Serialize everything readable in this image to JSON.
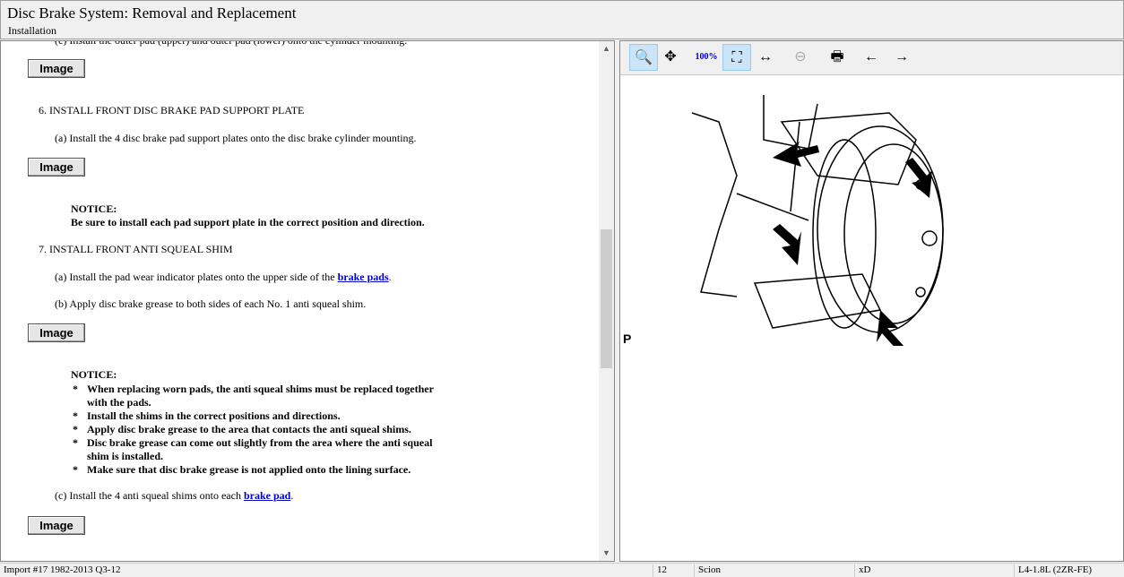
{
  "header": {
    "title": "Disc Brake System:  Removal and Replacement",
    "subtitle": "Installation"
  },
  "content": {
    "cut_line": "(c) Install the outer pad (upper) and outer pad (lower) onto the cylinder mounting.",
    "image_label": "Image",
    "step6": "6.   INSTALL FRONT DISC BRAKE PAD SUPPORT PLATE",
    "step6a": "(a) Install the 4 disc brake pad support plates onto the disc brake cylinder mounting.",
    "notice_label": "NOTICE:",
    "notice1": "Be sure to install each pad support plate in the correct position and direction.",
    "step7": "7.   INSTALL FRONT ANTI SQUEAL SHIM",
    "step7a_pre": "(a) Install the pad wear indicator plates onto the upper side of the ",
    "step7a_link": "brake pads",
    "step7b": "(b) Apply disc brake grease to both sides of each No. 1 anti squeal shim.",
    "notice2": [
      "When replacing worn pads, the anti squeal shims must be replaced together",
      "with the pads.",
      "Install the shims in the correct positions and directions.",
      "Apply disc brake grease to the area that contacts the anti squeal shims.",
      "Disc brake grease can come out slightly from the area where the anti squeal",
      "shim is installed.",
      "Make sure that disc brake grease is not applied onto the lining surface."
    ],
    "bullet": "*",
    "step7c_pre": "(c) Install the 4 anti squeal shims onto each ",
    "step7c_link": "brake pad"
  },
  "viewer": {
    "tools": [
      "zoom-in",
      "pan",
      "zoom-100",
      "zoom-fit",
      "zoom-width",
      "zoom-out",
      "print",
      "prev-image",
      "next-image"
    ],
    "diagram_label": "P"
  },
  "status": {
    "source": "Import #17 1982-2013 Q3-12",
    "year": "12",
    "make": "Scion",
    "model": "xD",
    "engine": "L4-1.8L (2ZR-FE)"
  }
}
